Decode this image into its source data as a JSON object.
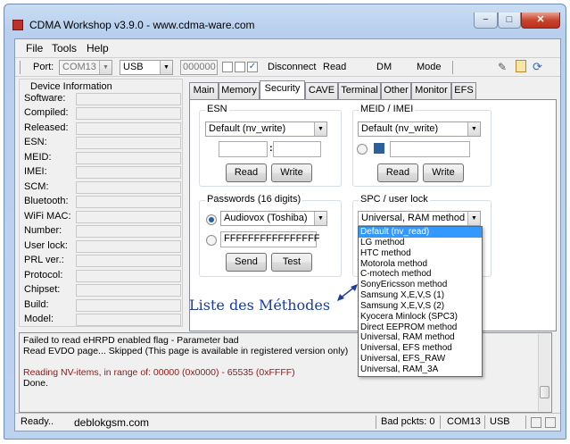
{
  "window": {
    "title": "CDMA Workshop v3.9.0   -   www.cdma-ware.com",
    "caption_min": "−",
    "caption_max": "□",
    "caption_close": "✕"
  },
  "menu": [
    "File",
    "Tools",
    "Help"
  ],
  "toolbar": {
    "port_label": "Port:",
    "port_value": "COM13",
    "conn_value": "USB",
    "spc_value": "000000",
    "disconnect": "Disconnect",
    "read": "Read",
    "dm": "DM",
    "mode": "Mode",
    "icons": [
      "pin-icon",
      "notepad-icon",
      "refresh-icon"
    ]
  },
  "device_info": {
    "title": "Device Information",
    "fields": [
      "Software:",
      "Compiled:",
      "Released:",
      "ESN:",
      "MEID:",
      "IMEI:",
      "SCM:",
      "Bluetooth:",
      "WiFi MAC:",
      "Number:",
      "User lock:",
      "PRL ver.:",
      "Protocol:",
      "Chipset:",
      "Build:",
      "Model:"
    ]
  },
  "tabs": [
    "Main",
    "Memory",
    "Security",
    "CAVE",
    "Terminal",
    "Other",
    "Monitor",
    "EFS"
  ],
  "active_tab": "Security",
  "esn": {
    "title": "ESN",
    "method": "Default (nv_write)",
    "sep": ":",
    "read": "Read",
    "write": "Write"
  },
  "meid": {
    "title": "MEID / IMEI",
    "method": "Default (nv_write)",
    "read": "Read",
    "write": "Write"
  },
  "passwords": {
    "title": "Passwords (16 digits)",
    "method": "Audiovox (Toshiba)",
    "value": "FFFFFFFFFFFFFFFF",
    "send": "Send",
    "test": "Test"
  },
  "spc": {
    "title": "SPC / user lock",
    "method": "Universal, RAM method"
  },
  "spc_dropdown": [
    "Default (nv_read)",
    "LG method",
    "HTC method",
    "Motorola method",
    "C-motech method",
    "SonyEricsson method",
    "Samsung X,E,V,S (1)",
    "Samsung X,E,V,S (2)",
    "Kyocera Minlock (SPC3)",
    "Direct EEPROM method",
    "Universal, RAM method",
    "Universal, EFS method",
    "Universal, EFS_RAW",
    "Universal, RAM_3A"
  ],
  "annotation": "Liste des Méthodes",
  "log": [
    "Failed to read eHRPD enabled flag   -   Parameter bad",
    "Read EVDO page... Skipped          (This page is available in registered version only)",
    "Reading NV-items, in range of:   00000 (0x0000) - 65535 (0xFFFF)",
    "Done."
  ],
  "log_colors": {
    "normal": "#000000",
    "highlight": "#8b1a1a"
  },
  "status": {
    "ready": "Ready..",
    "watermark": "deblokgsm.com",
    "bad_packets": "Bad pckts: 0",
    "port": "COM13",
    "conn": "USB"
  }
}
